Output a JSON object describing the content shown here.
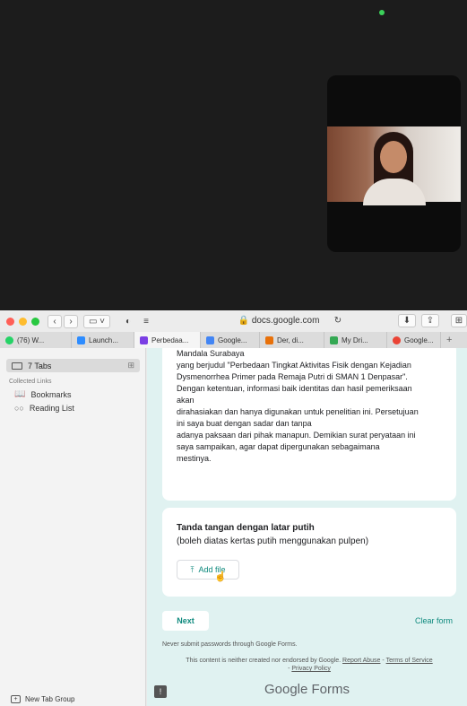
{
  "browser": {
    "address": "docs.google.com",
    "tabs": [
      {
        "label": "(76) W...",
        "color": "#25d366"
      },
      {
        "label": "Launch...",
        "color": "#2d8cff"
      },
      {
        "label": "Perbedaa...",
        "color": "#7b3fe4"
      },
      {
        "label": "Google...",
        "color": "#4285f4"
      },
      {
        "label": "Der, di...",
        "color": "#e8710a"
      },
      {
        "label": "My Dri...",
        "color": "#34a853"
      },
      {
        "label": "Google...",
        "color": "#ea4335"
      }
    ]
  },
  "sidebar": {
    "tabs_label": "7 Tabs",
    "collected_heading": "Collected Links",
    "bookmarks": "Bookmarks",
    "reading_list": "Reading List",
    "new_tab_group": "New Tab Group"
  },
  "form": {
    "statement_lines": [
      "Mandala Surabaya",
      "yang berjudul \"Perbedaan Tingkat Aktivitas Fisik dengan Kejadian",
      "Dysmenorrhea Primer pada Remaja Putri di SMAN 1 Denpasar\".",
      "Dengan ketentuan, informasi baik identitas dan hasil pemeriksaan",
      "akan",
      "dirahasiakan dan hanya digunakan untuk penelitian ini. Persetujuan",
      "ini saya buat dengan sadar dan tanpa",
      "adanya paksaan dari pihak manapun. Demikian surat peryataan ini",
      "saya sampaikan, agar dapat dipergunakan sebagaimana",
      "mestinya."
    ],
    "question_title": "Tanda tangan dengan latar putih",
    "question_sub": "(boleh diatas kertas putih menggunakan pulpen)",
    "add_file": "Add file",
    "next": "Next",
    "clear": "Clear form",
    "never_submit": "Never submit passwords through Google Forms.",
    "disclaimer_text": "This content is neither created nor endorsed by Google.",
    "report_abuse": "Report Abuse",
    "terms": "Terms of Service",
    "privacy": "Privacy Policy",
    "brand_google": "Google",
    "brand_forms": "Forms"
  },
  "colors": {
    "accent": "#0f8a7e",
    "form_bg": "#e0f2f1"
  }
}
